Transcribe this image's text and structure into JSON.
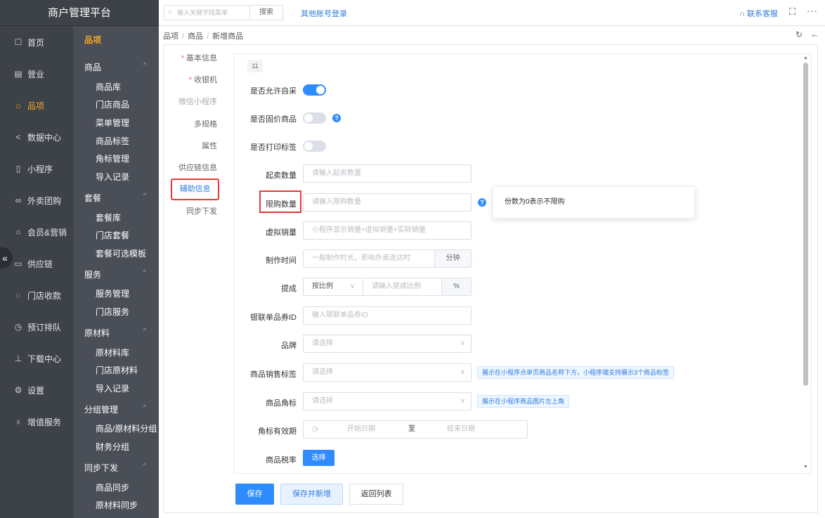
{
  "app": {
    "title": "商户管理平台"
  },
  "nav": [
    {
      "icon": "file-icon",
      "label": "首页"
    },
    {
      "icon": "calendar-icon",
      "label": "营业"
    },
    {
      "icon": "bag-icon",
      "label": "品项"
    },
    {
      "icon": "share-icon",
      "label": "数据中心"
    },
    {
      "icon": "phone-icon",
      "label": "小程序"
    },
    {
      "icon": "group-icon",
      "label": "外卖团购"
    },
    {
      "icon": "user-icon",
      "label": "会员&营销"
    },
    {
      "icon": "truck-icon",
      "label": "供应链"
    },
    {
      "icon": "wallet-icon",
      "label": "门店收款"
    },
    {
      "icon": "clock-icon",
      "label": "预订排队"
    },
    {
      "icon": "download-icon",
      "label": "下载中心"
    },
    {
      "icon": "gear-icon",
      "label": "设置"
    },
    {
      "icon": "gift-icon",
      "label": "增值服务"
    }
  ],
  "submenu": {
    "title": "品项",
    "groups": [
      {
        "label": "商品",
        "items": [
          "商品库",
          "门店商品",
          "菜单管理",
          "商品标签",
          "角标管理",
          "导入记录"
        ]
      },
      {
        "label": "套餐",
        "items": [
          "套餐库",
          "门店套餐",
          "套餐可选模板"
        ]
      },
      {
        "label": "服务",
        "items": [
          "服务管理",
          "门店服务"
        ]
      },
      {
        "label": "原材料",
        "items": [
          "原材料库",
          "门店原材料",
          "导入记录"
        ]
      },
      {
        "label": "分组管理",
        "items": [
          "商品/原材料分组",
          "财务分组"
        ]
      },
      {
        "label": "同步下发",
        "items": [
          "商品同步",
          "原材料同步"
        ]
      }
    ]
  },
  "topbar": {
    "search_placeholder": "输入关键字找菜单",
    "search_button": "搜索",
    "other_login": "其他账号登录",
    "contact": "联系客服"
  },
  "breadcrumb": [
    "品项",
    "商品",
    "新增商品"
  ],
  "tabs": {
    "basic": "基本信息",
    "cashier": "收银机",
    "wechat": "微信小程序",
    "spec": "多规格",
    "attr": "属性",
    "supply": "供应链信息",
    "aux": "辅助信息",
    "sync": "同步下发"
  },
  "form": {
    "badge": "11",
    "allow_purchase": {
      "label": "是否允许自采",
      "on": true
    },
    "fixed_price": {
      "label": "是否固价商品",
      "on": false
    },
    "print_label": {
      "label": "是否打印标签",
      "on": false
    },
    "min_qty": {
      "label": "起卖数量",
      "placeholder": "请输入起卖数量"
    },
    "limit_qty": {
      "label": "限购数量",
      "placeholder": "请输入限购数量",
      "tooltip": "份数为0表示不限购"
    },
    "virtual_sales": {
      "label": "虚拟销量",
      "placeholder": "小程序显示销量=虚拟销量+实际销量"
    },
    "make_time": {
      "label": "制作时间",
      "placeholder": "一般制作时长，影响外卖送达时",
      "unit": "分钟"
    },
    "commission": {
      "label": "提成",
      "mode": "按比例",
      "placeholder": "请输入提成比例",
      "unit": "%"
    },
    "unionpay": {
      "label": "银联单品券ID",
      "placeholder": "输入银联单品券ID"
    },
    "brand": {
      "label": "品牌",
      "placeholder": "请选择"
    },
    "sales_tag": {
      "label": "商品销售标签",
      "placeholder": "请选择",
      "hint": "展示在小程序点单页商品名称下方，小程序端支持展示3个商品标签"
    },
    "corner": {
      "label": "商品角标",
      "placeholder": "请选择",
      "hint": "展示在小程序商品图片左上角"
    },
    "corner_period": {
      "label": "角标有效期",
      "start": "开始日期",
      "to": "至",
      "end": "结束日期"
    },
    "tax": {
      "label": "商品税率",
      "button": "选择"
    }
  },
  "actions": {
    "save": "保存",
    "save_new": "保存并新增",
    "back": "返回列表"
  },
  "colors": {
    "sidebar": "#3d4148",
    "submenu": "#4a4e56",
    "accent": "#f5a623",
    "primary": "#2f8cff",
    "highlight": "#e53935"
  }
}
